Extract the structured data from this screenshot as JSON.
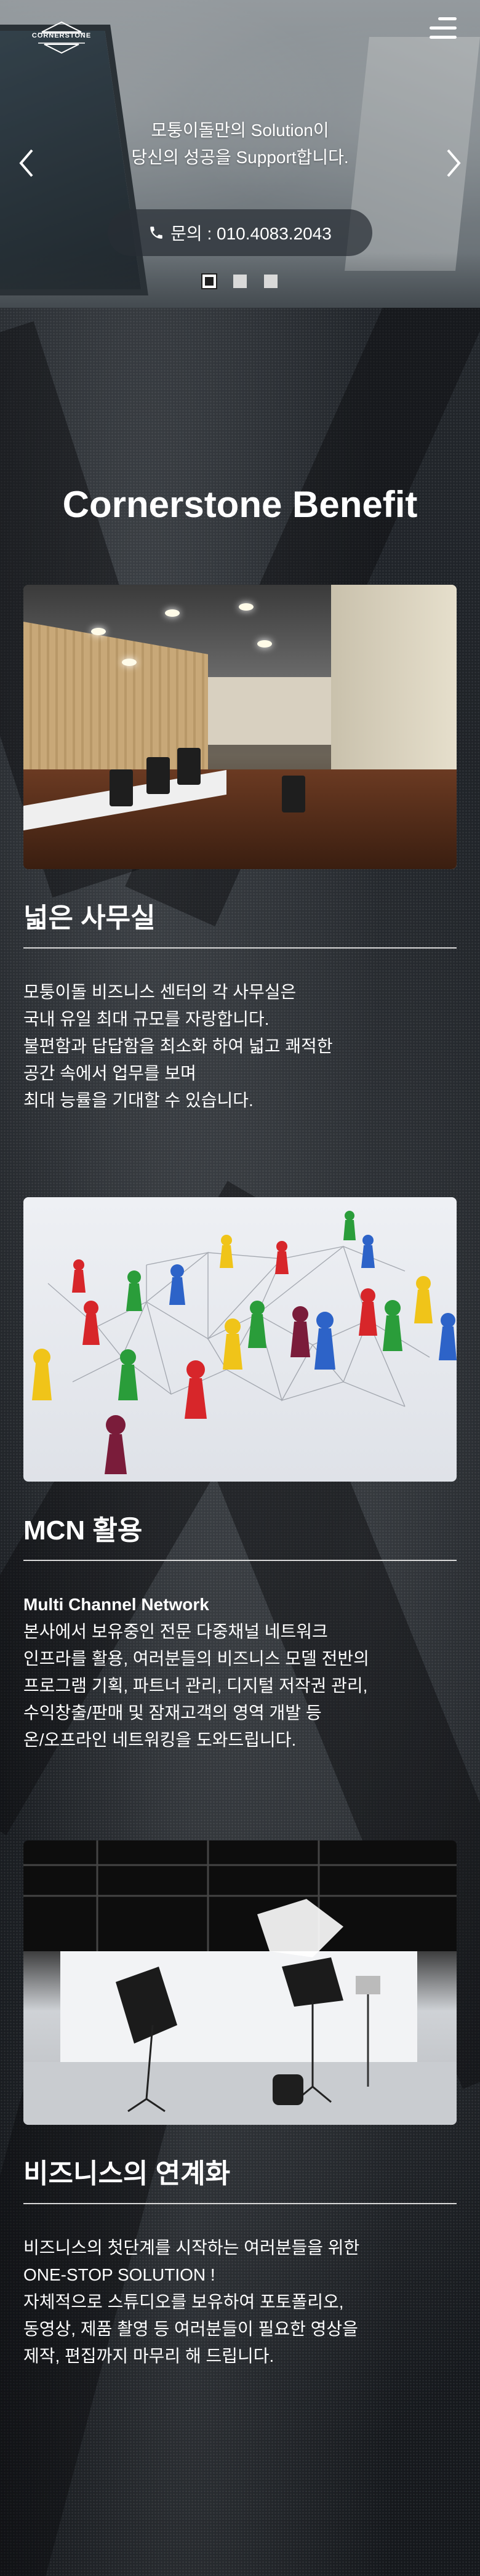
{
  "header": {
    "logo_text": "CORNERSTONE",
    "menu_icon": "hamburger-menu-icon"
  },
  "hero": {
    "line1": "모퉁이돌만의 Solution이",
    "line2": "당신의 성공을 Support합니다.",
    "contact_label": "문의 : 010.4083.2043",
    "contact_icon": "phone-icon",
    "prev_icon": "chevron-left-icon",
    "next_icon": "chevron-right-icon",
    "slide_count": 3,
    "active_slide": 1
  },
  "benefit": {
    "title": "Cornerstone Benefit",
    "cards": [
      {
        "title": "넓은 사무실",
        "lines": [
          "모퉁이돌 비즈니스 센터의 각 사무실은",
          "국내 유일 최대 규모를 자랑합니다.",
          "불편함과 답답함을 최소화 하여 넓고 쾌적한",
          "공간 속에서 업무를 보며",
          "최대 능률을 기대할 수 있습니다."
        ]
      },
      {
        "title": "MCN 활용",
        "subtitle": "Multi Channel Network",
        "lines": [
          "본사에서 보유중인 전문 다중채널 네트워크",
          "인프라를 활용, 여러분들의 비즈니스 모델 전반의",
          "프로그램 기획, 파트너 관리, 디지털 저작권 관리,",
          "수익창출/판매 및 잠재고객의 영역 개발 등",
          "온/오프라인 네트워킹을 도와드립니다."
        ]
      },
      {
        "title": "비즈니스의 연계화",
        "lines": [
          "비즈니스의 첫단계를 시작하는 여러분들을 위한",
          "ONE-STOP SOLUTION !",
          "자체적으로 스튜디오를 보유하여 포토폴리오,",
          "동영상, 제품 촬영 등 여러분들이 필요한 영상을",
          "제작, 편집까지 마무리 해 드립니다."
        ]
      }
    ]
  }
}
